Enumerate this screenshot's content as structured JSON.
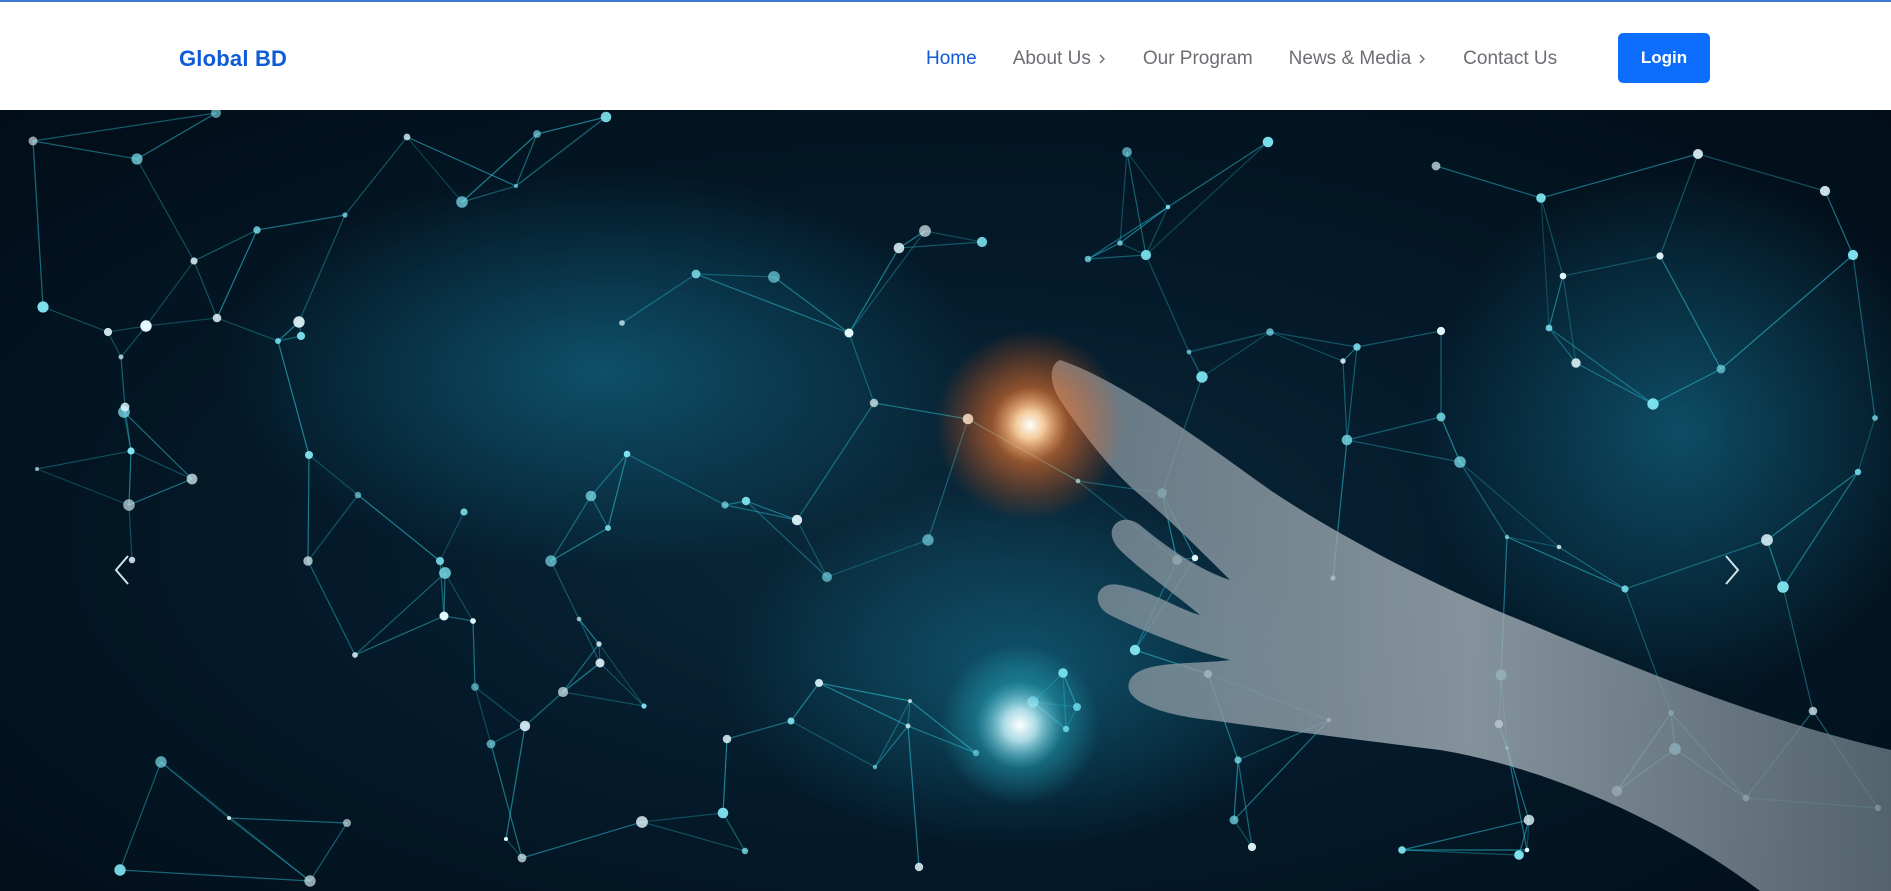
{
  "brand": {
    "name": "Global BD"
  },
  "nav": {
    "items": [
      {
        "label": "Home",
        "active": true,
        "has_submenu": false
      },
      {
        "label": "About Us",
        "active": false,
        "has_submenu": true
      },
      {
        "label": "Our Program",
        "active": false,
        "has_submenu": false
      },
      {
        "label": "News & Media",
        "active": false,
        "has_submenu": true
      },
      {
        "label": "Contact Us",
        "active": false,
        "has_submenu": false
      }
    ]
  },
  "header": {
    "login_label": "Login"
  },
  "hero": {
    "image": "technology network hand touching glowing node",
    "prev_icon": "chevron-left-icon",
    "next_icon": "chevron-right-icon"
  },
  "colors": {
    "accent": "#0d5bd7",
    "button": "#0d6efd",
    "nav_text": "#6b6f74",
    "hero_bg": "#041a2a",
    "network": "#2fc4d8",
    "glow": "#ff7a2a"
  }
}
